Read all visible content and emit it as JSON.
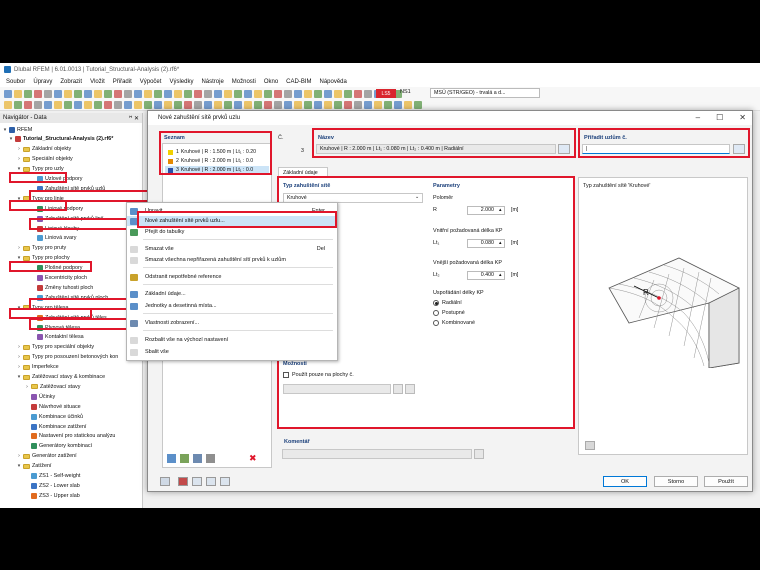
{
  "app": {
    "title": "Dlubal RFEM | 6.01.0013 | Tutorial_Structural-Analysis (2).rf6*",
    "menu": [
      "Soubor",
      "Úpravy",
      "Zobrazit",
      "Vložit",
      "Přiřadit",
      "Výpočet",
      "Výsledky",
      "Nástroje",
      "Možnosti",
      "Okno",
      "CAD-BIM",
      "Nápověda"
    ],
    "toolbar_ls": "LS5",
    "toolbar_ns": "NS1",
    "toolbar_combo": "MSÚ (STR/GEO) - trvalá a d..."
  },
  "navigator": {
    "title": "Navigátor - Data",
    "pin": "ꟸ ✕",
    "root": "RFEM",
    "model": "Tutorial_Structural-Analysis (2).rf6*",
    "items": [
      "Základní objekty",
      "Speciální objekty",
      "Typy pro uzly",
      "Uzlové podpory",
      "Zahuštění sítě prvků uzlů",
      "Typy pro linie",
      "Liniové podpory",
      "Zahuštění sítě prvků linií",
      "Liniové klouby",
      "Liniová svary",
      "Typy pro pruty",
      "Typy pro plochy",
      "Plošné podpory",
      "Excentricity ploch",
      "Změny tuhosti ploch",
      "Zahuštění sítě prvků ploch",
      "Typy pro tělesa",
      "Zahuštění sítě prvků těles",
      "Plynová tělesa",
      "Kontaktní tělesa",
      "Typy pro speciální objekty",
      "Typy pro posouzení betonových kon",
      "Imperfekce",
      "Zatěžovací stavy & kombinace",
      "Zatěžovací stavy",
      "Účinky",
      "Návrhové situace",
      "Kombinace účinků",
      "Kombinace zatížení",
      "Nastavení pro statickou analýzu",
      "Generátory kombinací",
      "Generátor zatížení",
      "Zatížení",
      "ZS1 - Self-weight",
      "ZS2 - Lower slab",
      "ZS3 - Upper slab"
    ]
  },
  "context_menu": {
    "items": [
      {
        "label": "Upravit...",
        "shortcut": "Enter"
      },
      {
        "label": "Nové zahuštění sítě prvků uzlu...",
        "shortcut": ""
      },
      {
        "label": "Přejít do tabulky",
        "shortcut": ""
      },
      {
        "label": "Smazat vše",
        "shortcut": "Del"
      },
      {
        "label": "Smazat všechna nepřiřazená zahuštění sítí prvků k uzlům",
        "shortcut": ""
      },
      {
        "label": "Odstranit nepotřebné reference",
        "shortcut": ""
      },
      {
        "label": "Základní údaje...",
        "shortcut": ""
      },
      {
        "label": "Jednotky a desetinná místa...",
        "shortcut": ""
      },
      {
        "label": "Vlastnosti zobrazení...",
        "shortcut": ""
      },
      {
        "label": "Rozbalit vše na výchozí nastavení",
        "shortcut": ""
      },
      {
        "label": "Sbalit vše",
        "shortcut": ""
      }
    ]
  },
  "dialog": {
    "title": "Nové zahuštění sítě prvků uzlu",
    "list_label": "Seznam",
    "list_items": [
      {
        "num": "1",
        "text": "Kruhové | R : 1.500 m | Lt₁ : 0.20",
        "color": "#f1d000"
      },
      {
        "num": "2",
        "text": "Kruhové | R : 2.000 m | Lt₁ : 0.0",
        "color": "#e58a00"
      },
      {
        "num": "3",
        "text": "Kruhové | R : 2.000 m | Lt₁ : 0.0",
        "color": "#2a4fa8"
      }
    ],
    "no_label": "Č.",
    "no_value": "3",
    "name_label": "Název",
    "name_value": "Kruhové | R : 2.000 m | Lt₁ : 0.080 m | Lt₂ : 0.400 m | Radiální",
    "assign_label": "Přiřadit uzlům č.",
    "assign_value": "|",
    "tab": "Základní údaje",
    "type_label": "Typ zahuštění sítě",
    "type_value": "Kruhové",
    "params_label": "Parametry",
    "radius_group": "Poloměr",
    "r_label": "R",
    "r_value": "2.000",
    "r_unit": "[m]",
    "inner_group": "Vnitřní požadovaná délka KP",
    "lt1_label": "Lt₁",
    "lt1_value": "0.080",
    "lt1_unit": "[m]",
    "outer_group": "Vnější požadovaná délka KP",
    "lt2_label": "Lt₂",
    "lt2_value": "0.400",
    "lt2_unit": "[m]",
    "order_group": "Uspořádání délky KP",
    "radio": [
      "Radiální",
      "Postupné",
      "Kombinované"
    ],
    "preview_label": "Typ zahuštění sítě 'Kruhové'",
    "preview_r": "R",
    "options_label": "Možnosti",
    "only_surfaces": "Použít pouze na plochy č.",
    "comment_label": "Komentář",
    "ok": "OK",
    "cancel": "Storno",
    "apply": "Použít"
  },
  "colors": {
    "red_highlight": "#e0162b",
    "accent_blue": "#0078d7",
    "label_blue": "#1a3f7a"
  }
}
